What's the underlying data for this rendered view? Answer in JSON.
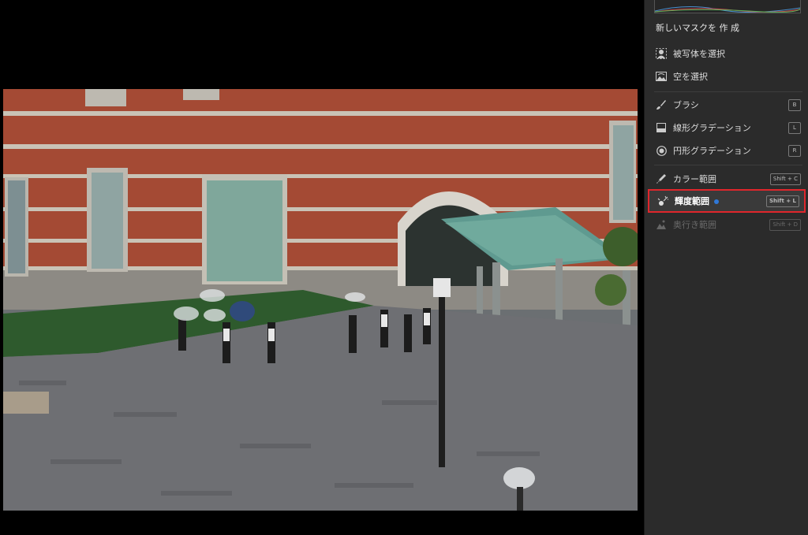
{
  "panel": {
    "title": "新しいマスクを 作 成",
    "items": [
      {
        "label": "被写体を選択",
        "icon": "person-select-icon",
        "shortcut": ""
      },
      {
        "label": "空を選択",
        "icon": "sky-select-icon",
        "shortcut": ""
      },
      {
        "label": "ブラシ",
        "icon": "brush-icon",
        "shortcut": "B"
      },
      {
        "label": "線形グラデーション",
        "icon": "linear-gradient-icon",
        "shortcut": "L"
      },
      {
        "label": "円形グラデーション",
        "icon": "radial-gradient-icon",
        "shortcut": "R"
      },
      {
        "label": "カラー範囲",
        "icon": "color-range-icon",
        "shortcut": "Shift + C"
      },
      {
        "label": "輝度範囲",
        "icon": "luminance-range-icon",
        "shortcut": "Shift + L",
        "selected": true
      },
      {
        "label": "奥行き範囲",
        "icon": "depth-range-icon",
        "shortcut": "Shift + D",
        "disabled": true
      }
    ]
  },
  "colors": {
    "panel_bg": "#2b2b2b",
    "highlight": "#e0262c",
    "indicator_dot": "#2f78d8"
  }
}
